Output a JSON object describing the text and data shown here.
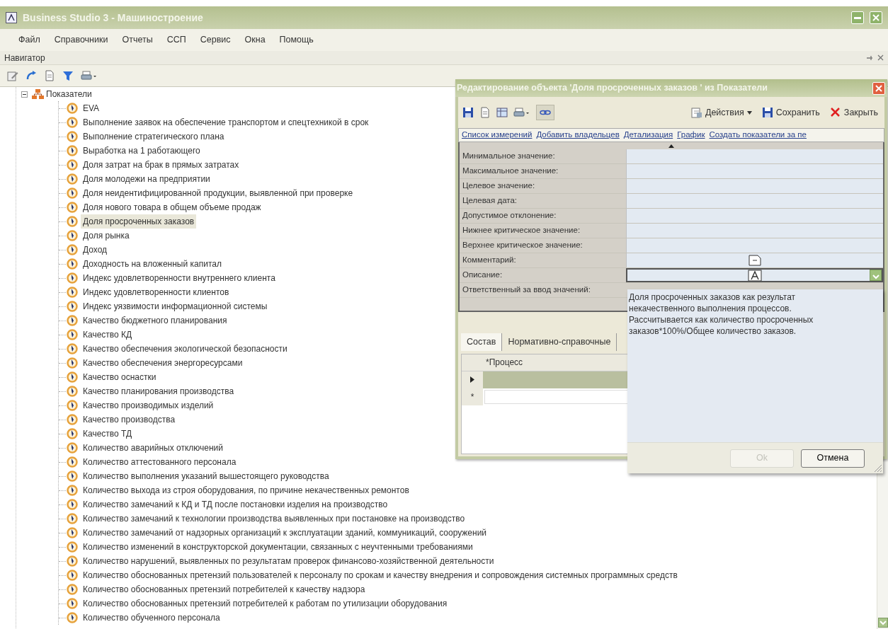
{
  "window": {
    "title": "Business Studio 3 - Машиностроение"
  },
  "menu": [
    "Файл",
    "Справочники",
    "Отчеты",
    "ССП",
    "Сервис",
    "Окна",
    "Помощь"
  ],
  "navigator": {
    "title": "Навигатор"
  },
  "tree": {
    "root": {
      "label": "Показатели",
      "expanded": true,
      "children": [
        {
          "label": "EVA",
          "selected": false
        },
        {
          "label": "Выполнение заявок на обеспечение транспортом и спецтехникой в срок",
          "selected": false
        },
        {
          "label": "Выполнение стратегического плана",
          "selected": false
        },
        {
          "label": "Выработка на 1 работающего",
          "selected": false
        },
        {
          "label": "Доля затрат на брак в прямых затратах",
          "selected": false
        },
        {
          "label": "Доля молодежи на предприятии",
          "selected": false
        },
        {
          "label": "Доля неидентифицированной продукции, выявленной при проверке",
          "selected": false
        },
        {
          "label": "Доля нового товара в общем объеме продаж",
          "selected": false
        },
        {
          "label": "Доля просроченных заказов",
          "selected": true
        },
        {
          "label": "Доля рынка",
          "selected": false
        },
        {
          "label": "Доход",
          "selected": false
        },
        {
          "label": "Доходность на вложенный капитал",
          "selected": false
        },
        {
          "label": "Индекс удовлетворенности внутреннего клиента",
          "selected": false
        },
        {
          "label": "Индекс удовлетворенности клиентов",
          "selected": false
        },
        {
          "label": "Индекс уязвимости информационной системы",
          "selected": false
        },
        {
          "label": "Качество бюджетного планирования",
          "selected": false
        },
        {
          "label": "Качество КД",
          "selected": false
        },
        {
          "label": "Качество обеспечения экологической безопасности",
          "selected": false
        },
        {
          "label": "Качество обеспечения энергоресурсами",
          "selected": false
        },
        {
          "label": "Качество оснастки",
          "selected": false
        },
        {
          "label": "Качество планирования производства",
          "selected": false
        },
        {
          "label": "Качество производимых изделий",
          "selected": false
        },
        {
          "label": "Качество производства",
          "selected": false
        },
        {
          "label": "Качество ТД",
          "selected": false
        },
        {
          "label": "Количество аварийных отключений",
          "selected": false
        },
        {
          "label": "Количество аттестованного персонала",
          "selected": false
        },
        {
          "label": "Количество выполнения указаний вышестоящего руководства",
          "selected": false
        },
        {
          "label": "Количество выхода из строя оборудования, по причине некачественных ремонтов",
          "selected": false
        },
        {
          "label": "Количество замечаний к КД и ТД после постановки изделия на производство",
          "selected": false
        },
        {
          "label": "Количество замечаний к технологии производства выявленных при постановке на производство",
          "selected": false
        },
        {
          "label": "Количество замечаний от надзорных организаций к эксплуатации зданий, коммуникаций, сооружений",
          "selected": false
        },
        {
          "label": "Количество изменений в конструкторской документации, связанных с неучтенными требованиями",
          "selected": false
        },
        {
          "label": "Количество нарушений, выявленных по результатам проверок финансово-хозяйственной деятельности",
          "selected": false
        },
        {
          "label": "Количество обоснованных претензий пользователей к персоналу по срокам и качеству внедрения и сопровождения системных программных средств",
          "selected": false
        },
        {
          "label": "Количество обоснованных претензий потребителей к качеству надзора",
          "selected": false
        },
        {
          "label": "Количество обоснованных претензий потребителей к работам по утилизации оборудования",
          "selected": false
        },
        {
          "label": "Количество обученного персонала",
          "selected": false
        }
      ]
    }
  },
  "dialog": {
    "title": "Редактирование объекта 'Доля просроченных заказов ' из Показатели",
    "toolbar_buttons": [
      {
        "label": "Действия",
        "kind": "actions"
      },
      {
        "label": "Сохранить",
        "kind": "save"
      },
      {
        "label": "Закрыть",
        "kind": "close"
      }
    ],
    "links": [
      "Список измерений",
      "Добавить владельцев",
      "Детализация",
      "График",
      "Создать показатели за пе"
    ],
    "fields": [
      {
        "label": "Минимальное значение:",
        "kind": "text"
      },
      {
        "label": "Максимальное значение:",
        "kind": "text"
      },
      {
        "label": "Целевое значение:",
        "kind": "text"
      },
      {
        "label": "Целевая дата:",
        "kind": "text"
      },
      {
        "label": "Допустимое отклонение:",
        "kind": "text"
      },
      {
        "label": "Нижнее критическое значение:",
        "kind": "text"
      },
      {
        "label": "Верхнее критическое значение:",
        "kind": "text"
      },
      {
        "label": "Комментарий:",
        "kind": "memo"
      },
      {
        "label": "Описание:",
        "kind": "dropdown",
        "expanded": true
      },
      {
        "label": "Ответственный за ввод значений:",
        "kind": "text"
      }
    ],
    "tabs": [
      {
        "label": "Состав",
        "selected": true
      },
      {
        "label": "Нормативно-справочные",
        "selected": false
      }
    ],
    "grid": {
      "columns": [
        "*Процесс"
      ],
      "rows": [
        {
          "selected": true
        }
      ],
      "new_row_marker": "*"
    }
  },
  "description_popup": {
    "text": "Доля просроченных заказов как результат некачественного выполнения процессов. Рассчитывается как количество просроченных заказов*100%/Общее количество заказов.",
    "buttons": [
      {
        "label": "Ok",
        "disabled": true
      },
      {
        "label": "Отмена",
        "disabled": false
      }
    ]
  }
}
